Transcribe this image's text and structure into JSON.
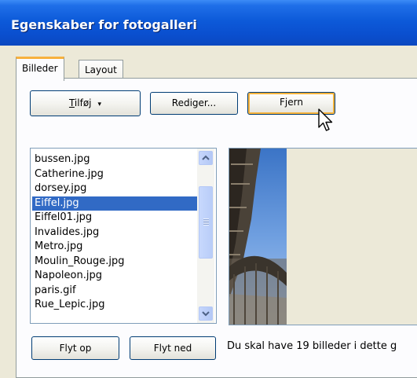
{
  "window": {
    "title": "Egenskaber for fotogalleri"
  },
  "tabs": [
    {
      "label": "Billeder",
      "active": true
    },
    {
      "label": "Layout",
      "active": false
    }
  ],
  "toolbar": {
    "add_label_accel": "T",
    "add_label_rest": "ilføj",
    "add_arrow": "▾",
    "edit_label": "Rediger...",
    "remove_label": "Fjern"
  },
  "files": [
    "bussen.jpg",
    "Catherine.jpg",
    "dorsey.jpg",
    "Eiffel.jpg",
    "Eiffel01.jpg",
    "Invalides.jpg",
    "Metro.jpg",
    "Moulin_Rouge.jpg",
    "Napoleon.jpg",
    "paris.gif",
    "Rue_Lepic.jpg"
  ],
  "selected_file": "Eiffel.jpg",
  "footer": {
    "move_up_label": "Flyt op",
    "move_down_label": "Flyt ned",
    "status_text": "Du skal have 19 billeder i dette g"
  },
  "colors": {
    "titlebar": "#0a54d6",
    "selection": "#316ac5",
    "focus_accent": "#f8b33b",
    "dialog_bg": "#ece9d8"
  },
  "icons": {
    "scroll_up": "chevron-up-icon",
    "scroll_down": "chevron-down-icon",
    "cursor": "mouse-pointer-icon"
  }
}
